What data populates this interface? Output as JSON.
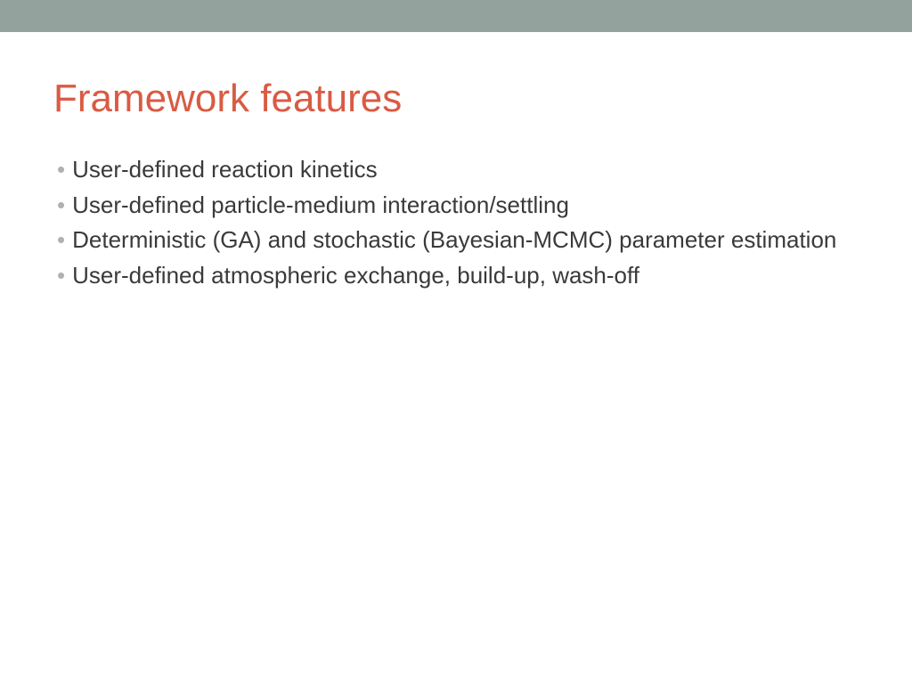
{
  "slide": {
    "title": "Framework features",
    "bullets": [
      "User-defined reaction kinetics",
      "User-defined particle-medium interaction/settling",
      "Deterministic (GA) and stochastic (Bayesian-MCMC) parameter estimation",
      "User-defined atmospheric exchange, build-up, wash-off"
    ]
  }
}
